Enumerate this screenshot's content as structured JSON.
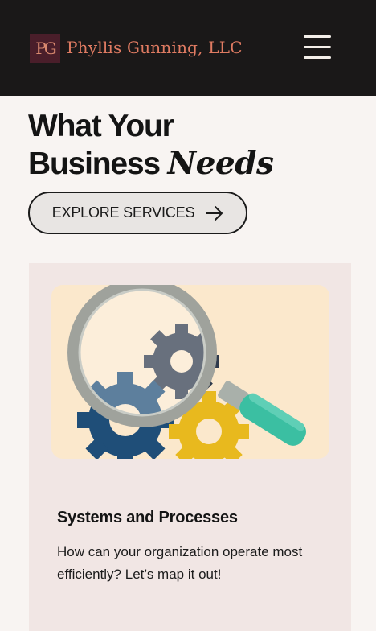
{
  "header": {
    "logo_initials": "PG",
    "brand_name": "Phyllis Gunning, LLC",
    "menu_icon": "hamburger-menu-icon"
  },
  "hero": {
    "title_line1": "What Your",
    "title_line2_plain": "Business",
    "title_line2_italic": "Needs",
    "cta_label": "EXPLORE SERVICES",
    "cta_icon": "arrow-right-icon"
  },
  "card": {
    "title": "Systems and Processes",
    "description": "How can your organization operate most efficiently? Let’s map it out!",
    "illustration": "magnifying-glass-over-gears"
  },
  "colors": {
    "header_bg": "#1a1818",
    "brand": "#e07b62",
    "page_bg": "#f8f4f2",
    "card_bg": "#f1e6e4",
    "illustration_bg": "#fbe8cc",
    "gear_navy": "#2f3a4c",
    "gear_blue": "#1f4e78",
    "gear_yellow": "#e8b91e",
    "handle_teal": "#3bbfa2"
  }
}
